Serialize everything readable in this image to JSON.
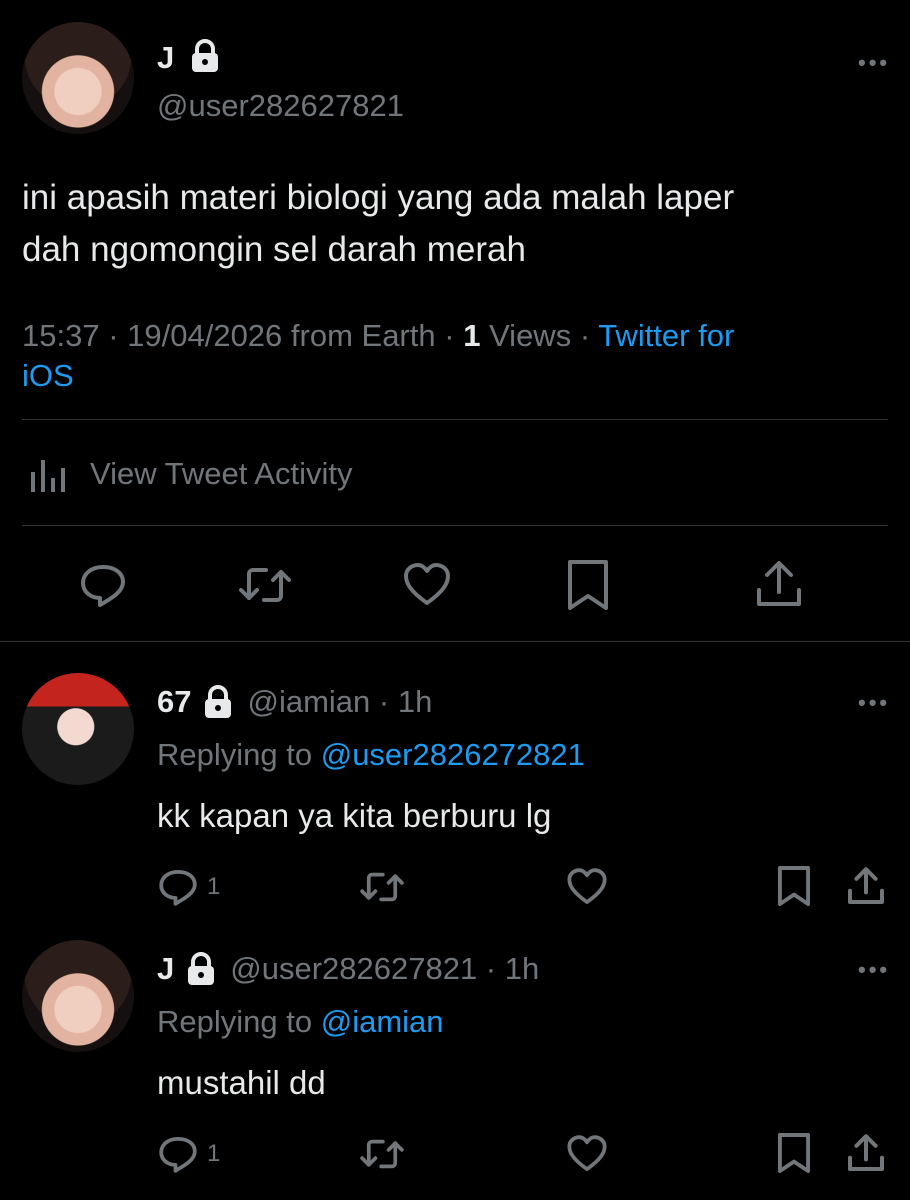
{
  "main_tweet": {
    "name": "J",
    "handle": "@user282627821",
    "text_line1": "ini apasih materi biologi yang ada malah laper",
    "text_line2": "dah ngomongin sel darah merah",
    "time": "15:37",
    "date": "19/04/2026 from Earth",
    "views_count": "1",
    "views_label": "Views",
    "source_part1": "Twitter for",
    "source_part2": "iOS",
    "activity_label": "View Tweet Activity"
  },
  "replies": [
    {
      "name": "67",
      "handle_time": "@iamian · 1h",
      "replying_prefix": "Replying to",
      "replying_to": "@user2826272821",
      "text": "kk kapan ya kita berburu lg",
      "reply_count": "1"
    },
    {
      "name": "J",
      "handle_time": "@user282627821 · 1h",
      "replying_prefix": "Replying to",
      "replying_to": "@iamian",
      "text": "mustahil dd",
      "reply_count": "1"
    }
  ],
  "icons": {
    "lock": "lock-icon",
    "more": "more-icon",
    "reply": "reply-icon",
    "retweet": "retweet-icon",
    "like": "heart-icon",
    "bookmark": "bookmark-icon",
    "share": "share-icon",
    "activity": "bar-chart-icon"
  },
  "colors": {
    "background": "#000000",
    "text": "#e7e9ea",
    "muted": "#71767b",
    "accent": "#1d9bf0",
    "divider": "#2f3336"
  }
}
